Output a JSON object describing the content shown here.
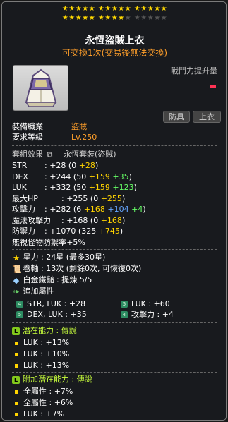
{
  "stars": {
    "rows": [
      "★★★★★ ★★★★★ ★★★★★",
      "★★★★★ ★★★★★ ★★★★★"
    ],
    "filled": 24,
    "max": 30
  },
  "item": {
    "name": "永恆盜賊上衣",
    "trade_note": "可交換1次(交易後無法交換)",
    "icon": "cloak-armor-icon"
  },
  "power": {
    "label": "戰鬥力提升量"
  },
  "tags": [
    "防具",
    "上衣"
  ],
  "job": {
    "label": "裝備職業",
    "value": "盜賊"
  },
  "level": {
    "label": "要求等級",
    "value": "Lv.250"
  },
  "set": {
    "label": "套組效果",
    "value": "永恆套裝(盜賊)"
  },
  "stats": [
    {
      "key": "STR",
      "total": ": +28",
      "open": " (0 ",
      "b1": "+28",
      "b2": "",
      "b3": "",
      "close": ")"
    },
    {
      "key": "DEX",
      "total": ": +244",
      "open": " (50 ",
      "b1": "+159",
      "b2": " +35",
      "b3": "",
      "close": ")"
    },
    {
      "key": "LUK",
      "total": ": +332",
      "open": " (50 ",
      "b1": "+159",
      "b2": " +123",
      "b3": "",
      "close": ")"
    },
    {
      "key": "最大HP",
      "total": ": +255",
      "open": " (0 ",
      "b1": "+255",
      "b2": "",
      "b3": "",
      "close": ")"
    },
    {
      "key": "攻擊力",
      "total": ": +282",
      "open": " (6 ",
      "b1": "+168",
      "b2": " +104",
      "b3": " +4",
      "close": ")"
    },
    {
      "key": "魔法攻擊力",
      "total": ": +168",
      "open": " (0 ",
      "b1": "+168",
      "b2": "",
      "b3": "",
      "close": ")"
    },
    {
      "key": "防禦力",
      "total": ": +1070",
      "open": " (325 ",
      "b1": "+745",
      "b2": "",
      "b3": "",
      "close": ")"
    },
    {
      "key": "無視怪物防禦率",
      "total": ": +5%",
      "open": "",
      "b1": "",
      "b2": "",
      "b3": "",
      "close": ""
    }
  ],
  "upgrades": {
    "star": "星力 : 24星 (最多30星)",
    "scroll": "卷軸 : 13次 (剩餘0次, 可恢復0次)",
    "hammer": "白金鐵鎚 : 提煉 5/5",
    "extra": "追加屬性"
  },
  "extra_stats": [
    {
      "badge": "4",
      "text": "STR, LUK : +28"
    },
    {
      "badge": "5",
      "text": "LUK : +60"
    },
    {
      "badge": "5",
      "text": "DEX, LUK : +35"
    },
    {
      "badge": "4",
      "text": "攻擊力 : +4"
    }
  ],
  "potential": {
    "title": "潛在能力 : 傳說",
    "lines": [
      "LUK : +13%",
      "LUK : +10%",
      "LUK : +13%"
    ]
  },
  "bonus_potential": {
    "title": "附加潛在能力 : 傳說",
    "lines": [
      "全屬性 : +7%",
      "全屬性 : +6%",
      "LUK : +7%"
    ]
  },
  "colors": {
    "gold": "#ffd400",
    "orange": "#ff9f2a",
    "blue": "#66a6ff",
    "green": "#66ff66",
    "lime": "#c8ff3c"
  }
}
